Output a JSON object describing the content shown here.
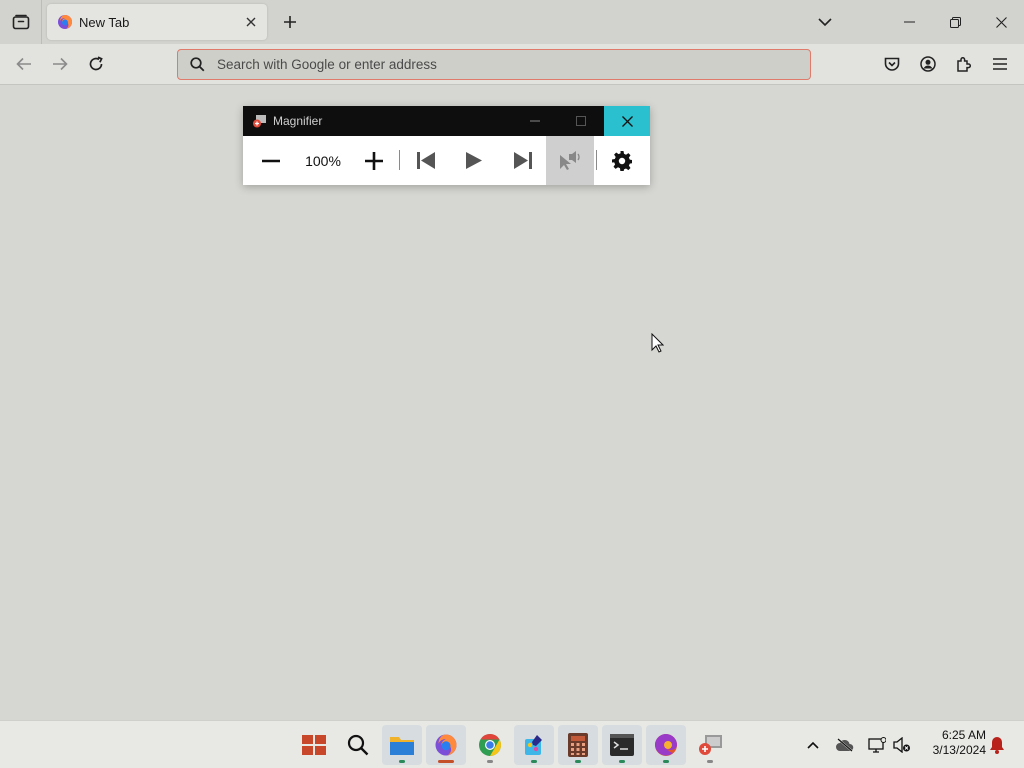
{
  "browser": {
    "tabs": [
      {
        "title": "New Tab",
        "active": true
      }
    ],
    "urlbar": {
      "placeholder": "Search with Google or enter address",
      "value": ""
    },
    "accent_color": "#e07a6a"
  },
  "magnifier": {
    "title": "Magnifier",
    "zoom_level": "100%",
    "close_color": "#2bc0cf"
  },
  "taskbar": {
    "apps": [
      {
        "name": "start",
        "icon": "windows-logo-icon"
      },
      {
        "name": "search",
        "icon": "search-icon"
      },
      {
        "name": "file-explorer",
        "icon": "folder-icon"
      },
      {
        "name": "firefox",
        "icon": "firefox-icon"
      },
      {
        "name": "chrome",
        "icon": "chrome-icon"
      },
      {
        "name": "paint",
        "icon": "paint-icon"
      },
      {
        "name": "calculator",
        "icon": "calculator-icon"
      },
      {
        "name": "terminal",
        "icon": "terminal-icon"
      },
      {
        "name": "edge",
        "icon": "edge-icon"
      },
      {
        "name": "magnifier",
        "icon": "magnifier-icon"
      }
    ],
    "clock": {
      "time": "6:25 AM",
      "date": "3/13/2024"
    }
  }
}
